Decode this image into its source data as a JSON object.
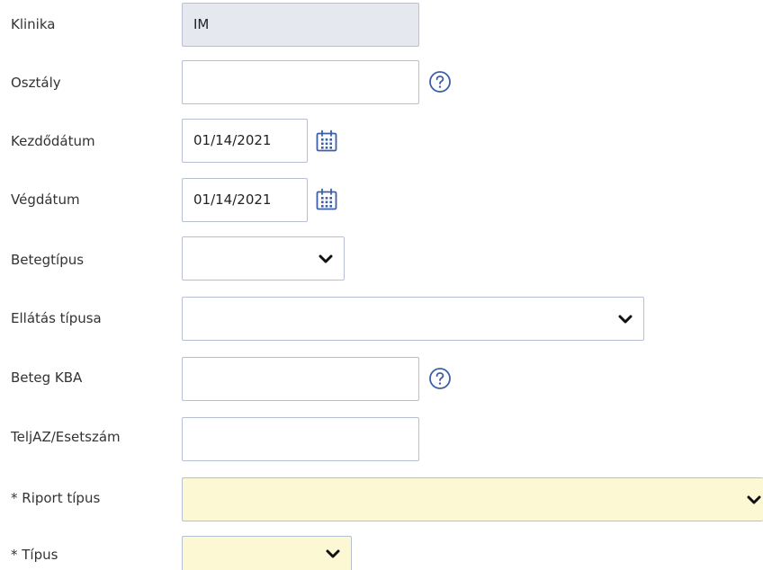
{
  "form": {
    "clinic": {
      "label": "Klinika",
      "value": "IM"
    },
    "department": {
      "label": "Osztály",
      "value": ""
    },
    "start_date": {
      "label": "Kezdődátum",
      "value": "01/14/2021"
    },
    "end_date": {
      "label": "Végdátum",
      "value": "01/14/2021"
    },
    "patient_type": {
      "label": "Betegtípus",
      "value": ""
    },
    "care_type": {
      "label": "Ellátás típusa",
      "value": ""
    },
    "patient_kba": {
      "label": "Beteg KBA",
      "value": ""
    },
    "case_number": {
      "label": "TeljAZ/Esetszám",
      "value": ""
    },
    "report_type": {
      "label": "* Riport típus",
      "value": ""
    },
    "type": {
      "label": "* Típus",
      "value": ""
    }
  },
  "icons": {
    "help": "help-circle-icon",
    "calendar": "calendar-icon",
    "dropdown": "chevron-down-icon"
  },
  "colors": {
    "accent": "#3d5fa8",
    "readonly_bg": "#e6e8ef",
    "required_bg": "#fdf8d4",
    "border": "#b7bfd2"
  }
}
